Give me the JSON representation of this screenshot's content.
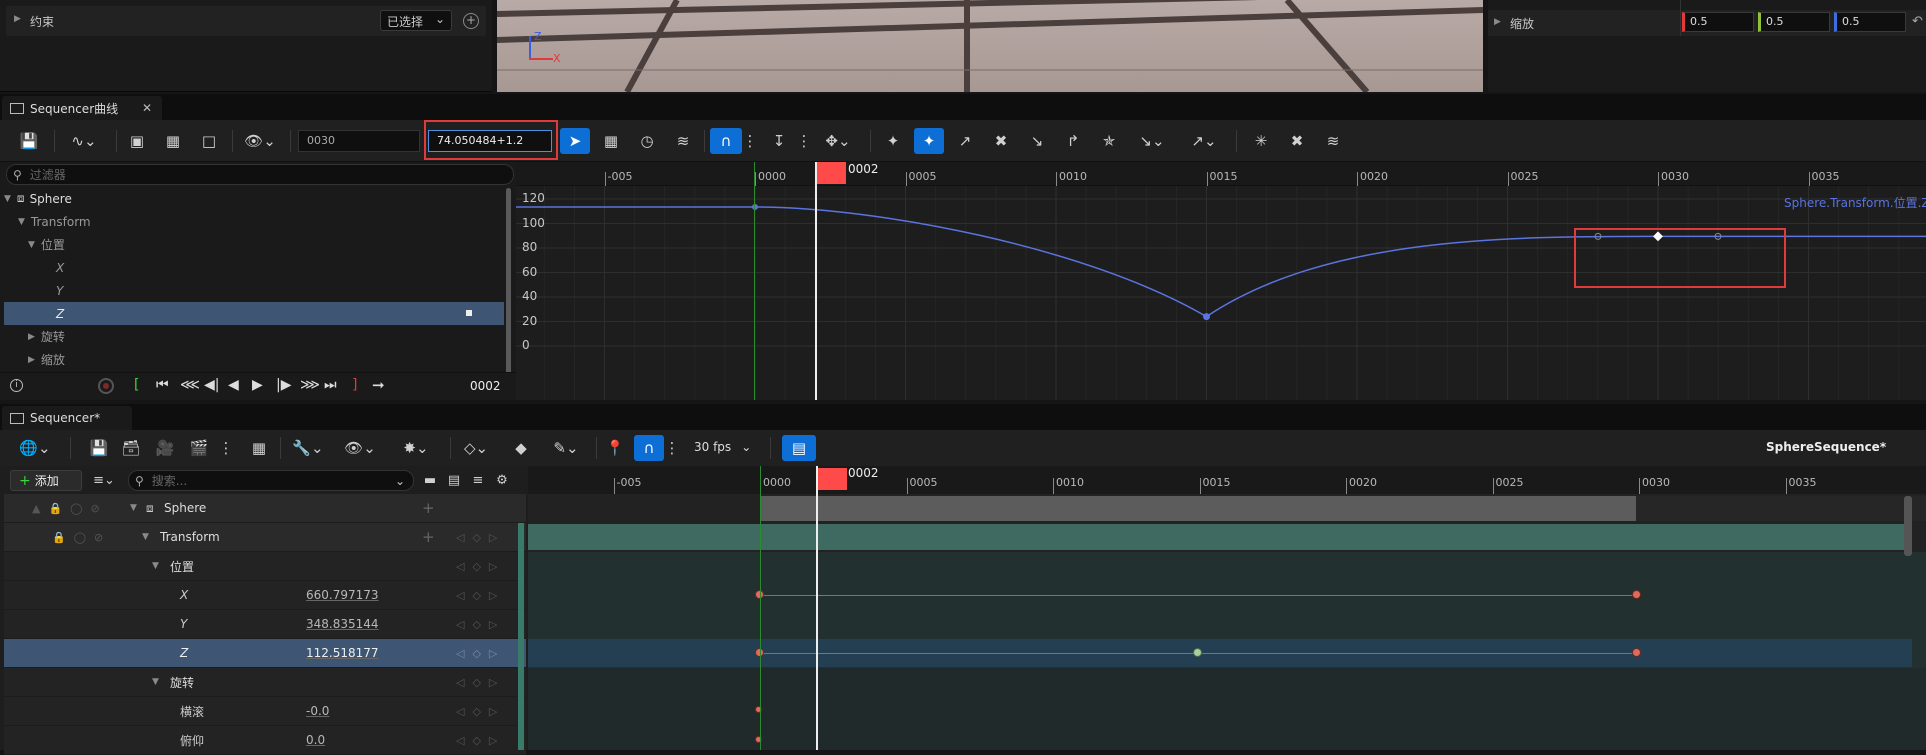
{
  "details_top": {
    "constraint_label": "约束",
    "dropdown": "已选择",
    "scale_label": "缩放",
    "scale_x": "0.5",
    "scale_y": "0.5",
    "scale_z": "0.5",
    "axis_z": "Z",
    "axis_x": "X"
  },
  "curve_tab": {
    "title": "Sequencer曲线"
  },
  "curve_toolbar": {
    "frame_value": "0030",
    "expression_value": "74.050484+1.2"
  },
  "curve_filter": {
    "placeholder": "过滤器"
  },
  "curve_tree": [
    {
      "label": "Sphere"
    },
    {
      "label": "Transform"
    },
    {
      "label": "位置"
    },
    {
      "label": "X"
    },
    {
      "label": "Y"
    },
    {
      "label": "Z"
    },
    {
      "label": "旋转"
    },
    {
      "label": "缩放"
    }
  ],
  "curve_transport": {
    "frame": "0002"
  },
  "curve_ruler": {
    "labels": [
      "-005",
      "0000",
      "0005",
      "0010",
      "0015",
      "0020",
      "0025",
      "0030",
      "0035"
    ],
    "playhead": "0002"
  },
  "curve_y_labels": [
    "120",
    "100",
    "80",
    "60",
    "40",
    "20",
    "0"
  ],
  "curve_channel_label": "Sphere.Transform.位置.Z",
  "curve_colors": {
    "curve": "#5a74e0",
    "selection": "#e03a3a",
    "playhead": "#ff4a4a"
  },
  "seq_tab": {
    "title": "Sequencer*"
  },
  "seq_toolbar": {
    "fps": "30 fps",
    "sequence_name": "SphereSequence*",
    "add_label": "添加",
    "search_placeholder": "搜索..."
  },
  "seq_ruler": {
    "labels": [
      "-005",
      "0000",
      "0005",
      "0010",
      "0015",
      "0020",
      "0025",
      "0030",
      "0035"
    ],
    "playhead": "0002"
  },
  "seq_tracks": [
    {
      "label": "Sphere",
      "value": ""
    },
    {
      "label": "Transform",
      "value": ""
    },
    {
      "label": "位置",
      "value": ""
    },
    {
      "label": "X",
      "value": "660.797173"
    },
    {
      "label": "Y",
      "value": "348.835144"
    },
    {
      "label": "Z",
      "value": "112.518177"
    },
    {
      "label": "旋转",
      "value": ""
    },
    {
      "label": "横滚",
      "value": "-0.0"
    },
    {
      "label": "俯仰",
      "value": "0.0"
    }
  ]
}
